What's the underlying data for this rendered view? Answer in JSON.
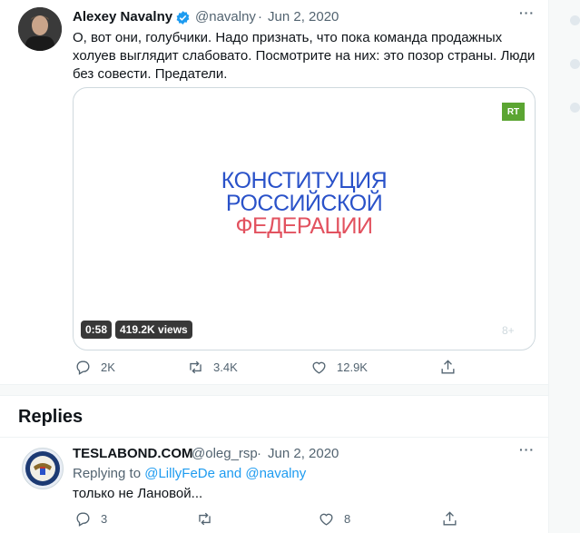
{
  "tweet": {
    "author_name": "Alexey Navalny",
    "handle": "@navalny",
    "separator": "·",
    "date": "Jun 2, 2020",
    "text_line1": "О, вот они, голубчики. Надо признать, что пока команда продажных",
    "text_line2": "холуев выглядит слабовато. Посмотрите на них: это позор страны. Люди",
    "text_line3": "без совести. Предатели.",
    "media": {
      "channel_logo": "RT",
      "title_line1": "КОНСТИТУЦИЯ",
      "title_line2": "РОССИЙСКОЙ",
      "title_line3": "ФЕДЕРАЦИИ",
      "duration": "0:58",
      "views": "419.2K views",
      "age_rating": "8+"
    },
    "actions": {
      "replies": "2K",
      "retweets": "3.4K",
      "likes": "12.9K"
    }
  },
  "replies_heading": "Replies",
  "reply": {
    "author_name": "TESLABOND.COM",
    "handle": "@oleg_rsp",
    "separator": "·",
    "date": "Jun 2, 2020",
    "replying_prefix": "Replying to",
    "replying_user1": "@LillyFeDe",
    "replying_and": "and",
    "replying_user2": "@navalny",
    "text": "только не Лановой...",
    "actions": {
      "replies": "3",
      "likes": "8"
    }
  },
  "colors": {
    "accent": "#1d9bf0",
    "konst_blue": "#2a52c9",
    "konst_red": "#e2525f",
    "rt_green": "#5ba532"
  },
  "icons": [
    "verified-badge-icon",
    "reply-icon",
    "retweet-icon",
    "like-icon",
    "share-icon",
    "more-icon"
  ]
}
